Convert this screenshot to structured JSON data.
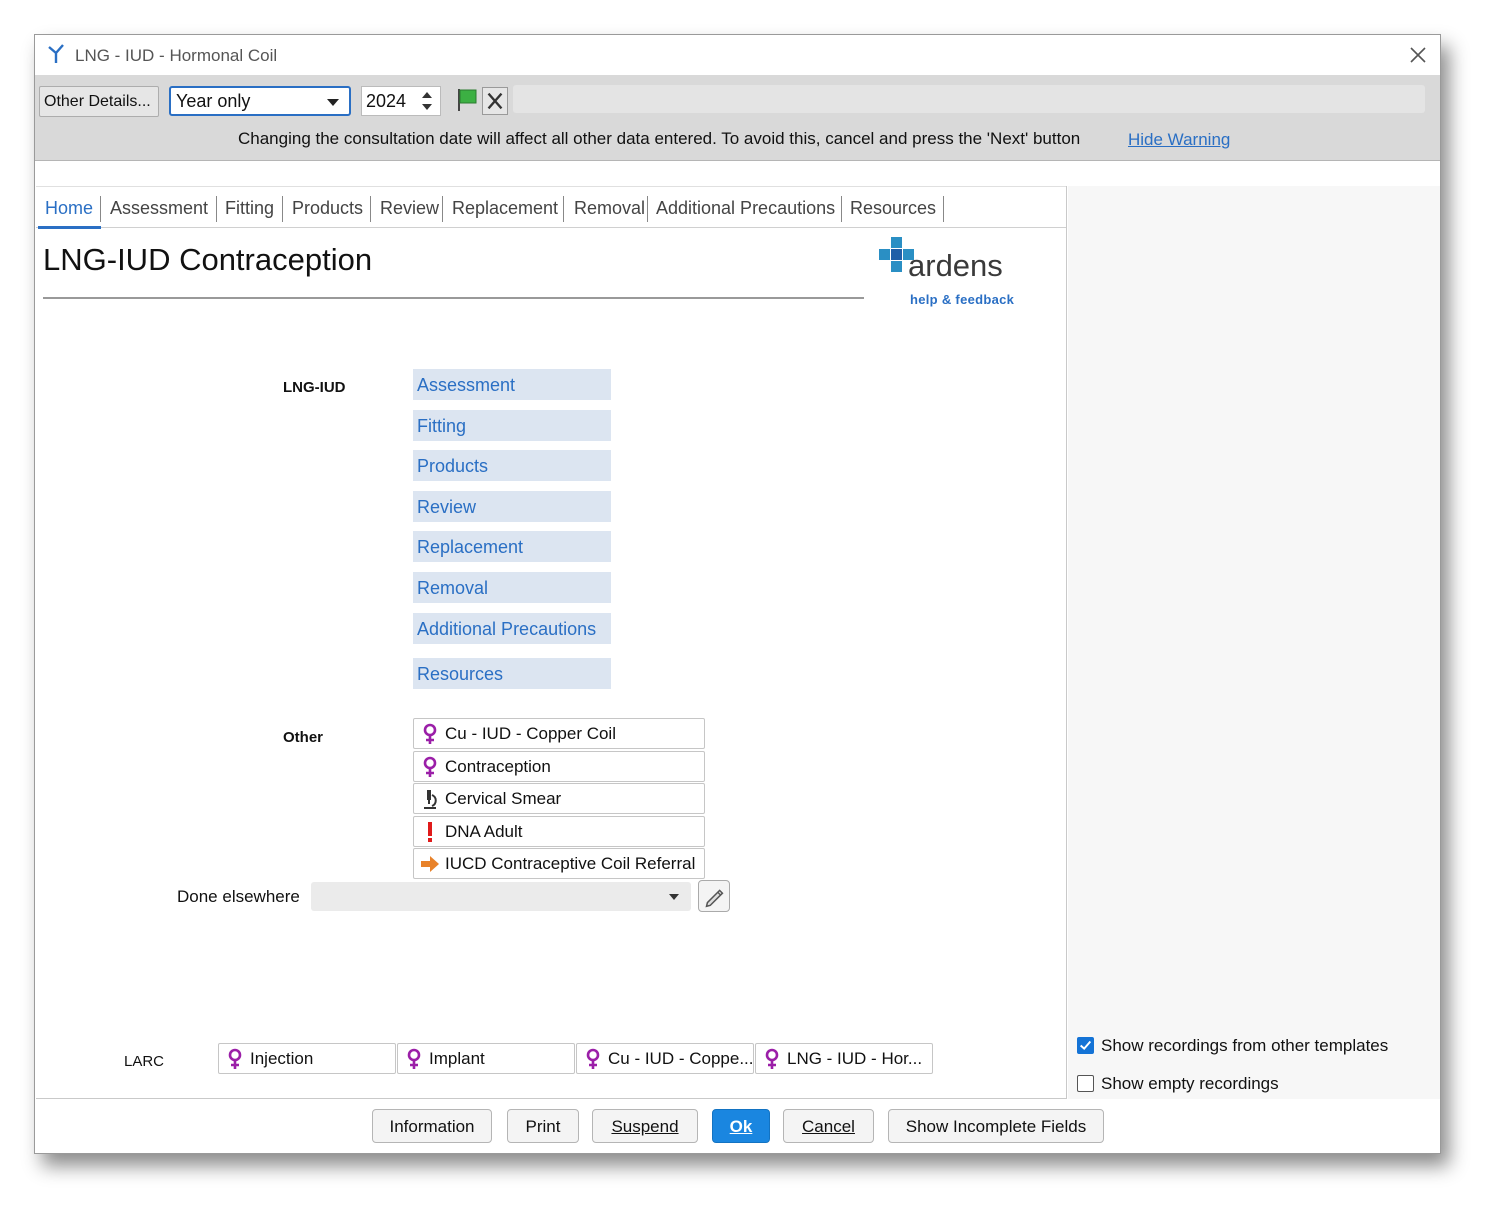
{
  "window": {
    "title": "LNG - IUD - Hormonal Coil"
  },
  "toolbar": {
    "other_details_label": "Other Details...",
    "date_mode": "Year only",
    "year_value": "2024",
    "warning_text": "Changing the consultation date will affect all other data entered. To avoid this, cancel and press the 'Next' button",
    "hide_warning_label": "Hide Warning"
  },
  "tabs": [
    "Home",
    "Assessment",
    "Fitting",
    "Products",
    "Review",
    "Replacement",
    "Removal",
    "Additional Precautions",
    "Resources"
  ],
  "page": {
    "title": "LNG-IUD Contraception"
  },
  "logo": {
    "name": "ardens",
    "subtitle": "help & feedback"
  },
  "lng_iud": {
    "label": "LNG-IUD",
    "links": [
      "Assessment",
      "Fitting",
      "Products",
      "Review",
      "Replacement",
      "Removal",
      "Additional Precautions",
      "Resources"
    ]
  },
  "other": {
    "label": "Other",
    "items": [
      {
        "label": "Cu - IUD - Copper Coil",
        "icon": "female-icon"
      },
      {
        "label": "Contraception",
        "icon": "female-icon"
      },
      {
        "label": "Cervical Smear",
        "icon": "microscope-icon"
      },
      {
        "label": "DNA Adult",
        "icon": "exclamation-icon"
      },
      {
        "label": "IUCD Contraceptive Coil Referral",
        "icon": "arrow-right-icon"
      }
    ]
  },
  "done_elsewhere": {
    "label": "Done elsewhere",
    "value": ""
  },
  "larc": {
    "label": "LARC",
    "items": [
      "Injection",
      "Implant",
      "Cu - IUD - Coppe...",
      "LNG - IUD - Hor..."
    ]
  },
  "options": {
    "show_other_templates": {
      "label": "Show recordings from other templates",
      "checked": true
    },
    "show_empty": {
      "label": "Show empty recordings",
      "checked": false
    }
  },
  "footer": {
    "information": "Information",
    "print": "Print",
    "suspend": "Suspend",
    "ok": "Ok",
    "cancel": "Cancel",
    "show_incomplete": "Show Incomplete Fields"
  },
  "colors": {
    "accent": "#2a6fc4",
    "link_bg": "#dce5f1",
    "female": "#9b1fa8",
    "warning_red": "#e01b1b",
    "referral_orange": "#e8822a"
  }
}
